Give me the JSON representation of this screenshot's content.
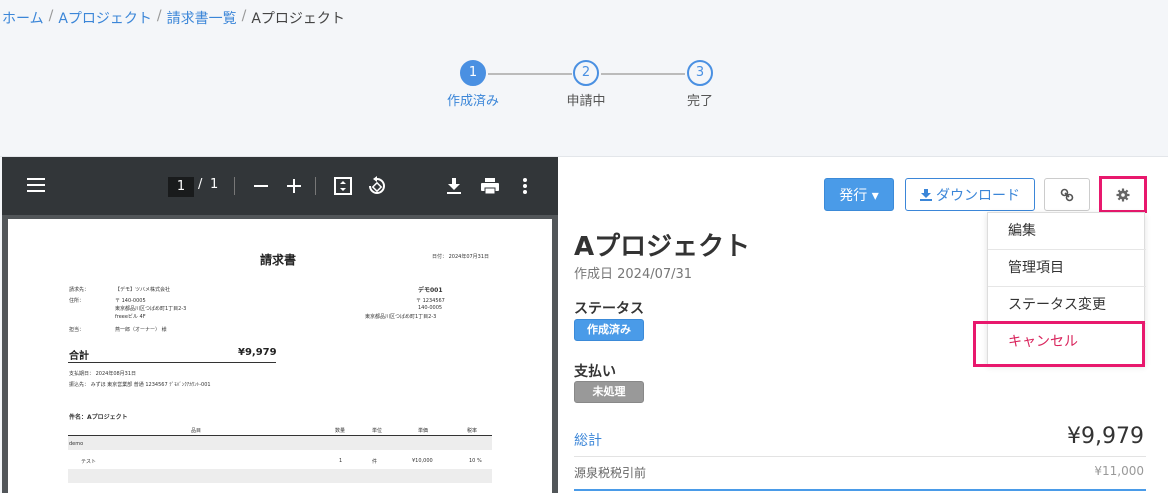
{
  "breadcrumb": {
    "items": [
      "ホーム",
      "Aプロジェクト",
      "請求書一覧"
    ],
    "current": "Aプロジェクト"
  },
  "steps": [
    {
      "num": "1",
      "label": "作成済み",
      "active": true
    },
    {
      "num": "2",
      "label": "申請中",
      "active": false
    },
    {
      "num": "3",
      "label": "完了",
      "active": false
    }
  ],
  "viewer": {
    "page_current": "1",
    "page_sep": "/",
    "page_total": "1"
  },
  "pdf": {
    "title": "請求書",
    "date": "日付： 2024年07月31日",
    "to_label": "請求先：",
    "to_value": "【デモ】ツバメ株式会社",
    "addr_label": "住所：",
    "addr_zip": "〒 140-0005",
    "addr_line1": "東京都品川区つばめ町1丁目2-3",
    "addr_line2": "freeeビル 4F",
    "person_label": "担当：",
    "person_value": "燕一郎（オーナー） 様",
    "company": "デモ001",
    "company_zip1": "〒 1234567",
    "company_zip2": "140-0005",
    "company_addr": "東京都品川区つばめ町1丁目2-3",
    "total_label": "合計",
    "total_value": "¥9,979",
    "due": "支払期日： 2024年08月31日",
    "bank": "振込先： みずほ 東京営業部 普通 1234567 ﾃﾞﾓﾊﾞﾝｸｱｶｳﾝﾄ-001",
    "subject": "件名：Aプロジェクト",
    "col_item": "品目",
    "col_qty": "数量",
    "col_unit": "単位",
    "col_price": "単価",
    "col_tax": "税率",
    "group": "demo",
    "row_item": "テスト",
    "row_qty": "1",
    "row_unit": "件",
    "row_price": "¥10,000",
    "row_tax": "10 %"
  },
  "toolbar": {
    "issue_label": "発行 ▾",
    "download_label": "ダウンロード"
  },
  "dropdown": {
    "items": [
      "編集",
      "管理項目",
      "ステータス変更",
      "キャンセル"
    ]
  },
  "invoice": {
    "title": "Aプロジェクト",
    "created": "作成日 2024/07/31",
    "status_label": "ステータス",
    "status_value": "作成済み",
    "payment_label": "支払い",
    "payment_value": "未処理",
    "total_label": "総計",
    "total_value": "¥9,979",
    "withholding_label": "源泉税税引前",
    "withholding_value": "¥11,000"
  },
  "colors": {
    "accent": "#4a9be8",
    "highlight": "#e8186d",
    "cancel": "#d9245c"
  }
}
